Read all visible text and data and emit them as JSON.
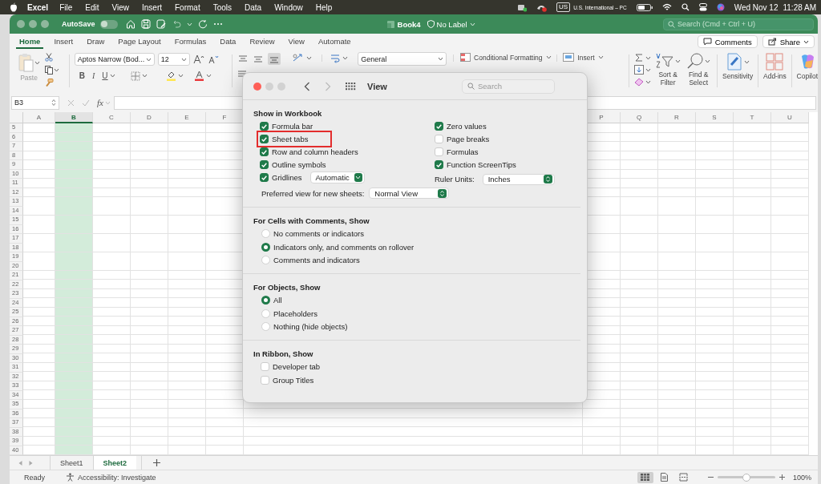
{
  "menu_bar": {
    "app": "Excel",
    "items": [
      "File",
      "Edit",
      "View",
      "Insert",
      "Format",
      "Tools",
      "Data",
      "Window",
      "Help"
    ],
    "keyboard_badge": "US",
    "keyboard_name": "U.S. International – PC",
    "date": "Wed Nov 12",
    "time": "11:28 AM"
  },
  "title_bar": {
    "autosave_label": "AutoSave",
    "autosave_on": false,
    "document": "Book4",
    "label": "No Label",
    "search_placeholder": "Search (Cmd + Ctrl + U)"
  },
  "tabs": [
    {
      "label": "Home",
      "selected": true
    },
    {
      "label": "Insert",
      "selected": false
    },
    {
      "label": "Draw",
      "selected": false
    },
    {
      "label": "Page Layout",
      "selected": false
    },
    {
      "label": "Formulas",
      "selected": false
    },
    {
      "label": "Data",
      "selected": false
    },
    {
      "label": "Review",
      "selected": false
    },
    {
      "label": "View",
      "selected": false
    },
    {
      "label": "Automate",
      "selected": false
    }
  ],
  "header_buttons": {
    "comments": "Comments",
    "share": "Share"
  },
  "ribbon": {
    "paste": "Paste",
    "font": "Aptos Narrow (Bod...",
    "font_size": "12",
    "bold": "B",
    "italic": "I",
    "underline": "U",
    "number_format": "General",
    "conditional_formatting": "Conditional Formatting",
    "insert": "Insert",
    "sort_filter": "Sort & Filter",
    "find_select": "Find & Select",
    "sensitivity": "Sensitivity",
    "add_ins": "Add-ins",
    "copilot": "Copilot"
  },
  "formula_bar": {
    "name_box": "B3",
    "fx": "fx"
  },
  "grid": {
    "columns_left": [
      {
        "label": "A",
        "selected": false
      },
      {
        "label": "B",
        "selected": true
      },
      {
        "label": "C",
        "selected": false
      },
      {
        "label": "D",
        "selected": false
      },
      {
        "label": "E",
        "selected": false
      },
      {
        "label": "F",
        "selected": false
      }
    ],
    "columns_right": [
      {
        "label": "P",
        "selected": false
      },
      {
        "label": "Q",
        "selected": false
      },
      {
        "label": "R",
        "selected": false
      },
      {
        "label": "S",
        "selected": false
      },
      {
        "label": "T",
        "selected": false
      },
      {
        "label": "U",
        "selected": false
      }
    ],
    "rows": [
      "5",
      "6",
      "7",
      "8",
      "9",
      "10",
      "11",
      "12",
      "13",
      "14",
      "15",
      "16",
      "17",
      "18",
      "19",
      "20",
      "21",
      "22",
      "23",
      "24",
      "25",
      "26",
      "27",
      "28",
      "29",
      "30",
      "31",
      "32",
      "33",
      "34",
      "35",
      "36",
      "37",
      "38",
      "39",
      "40"
    ]
  },
  "sheets": [
    {
      "label": "Sheet1",
      "selected": false
    },
    {
      "label": "Sheet2",
      "selected": true
    }
  ],
  "status_bar": {
    "status": "Ready",
    "accessibility": "Accessibility: Investigate",
    "views": [
      {
        "kind": "normal",
        "selected": true
      },
      {
        "kind": "page_layout",
        "selected": false
      },
      {
        "kind": "page_break",
        "selected": false
      }
    ],
    "zoom": {
      "level": 0.5,
      "reading": "100%"
    }
  },
  "dialog": {
    "title": "View",
    "search_placeholder": "Search",
    "sections": [
      {
        "kind": "workbook",
        "title": "Show in Workbook",
        "left": [
          {
            "label": "Formula bar",
            "checked": true,
            "highlighted": false
          },
          {
            "label": "Sheet tabs",
            "checked": true,
            "highlighted": true
          },
          {
            "label": "Row and column headers",
            "checked": true,
            "highlighted": false
          },
          {
            "label": "Outline symbols",
            "checked": true,
            "highlighted": false
          },
          {
            "label": "Gridlines",
            "checked": true,
            "highlighted": false,
            "dropdown": "Automatic"
          }
        ],
        "right": [
          {
            "kind": "checkbox",
            "label": "Zero values",
            "checked": true
          },
          {
            "kind": "checkbox",
            "label": "Page breaks",
            "checked": false
          },
          {
            "kind": "checkbox",
            "label": "Formulas",
            "checked": false
          },
          {
            "kind": "checkbox",
            "label": "Function ScreenTips",
            "checked": true
          },
          {
            "kind": "select",
            "label": "Ruler Units:",
            "value": "Inches"
          }
        ],
        "preferred": {
          "label": "Preferred view for new sheets:",
          "value": "Normal View"
        }
      },
      {
        "kind": "radios",
        "title": "For Cells with Comments, Show",
        "options": [
          {
            "label": "No comments or indicators",
            "selected": false
          },
          {
            "label": "Indicators only, and comments on rollover",
            "selected": true
          },
          {
            "label": "Comments and indicators",
            "selected": false
          }
        ]
      },
      {
        "kind": "radios",
        "title": "For Objects, Show",
        "options": [
          {
            "label": "All",
            "selected": true
          },
          {
            "label": "Placeholders",
            "selected": false
          },
          {
            "label": "Nothing (hide objects)",
            "selected": false
          }
        ]
      },
      {
        "kind": "checkboxes",
        "title": "In Ribbon, Show",
        "options": [
          {
            "label": "Developer tab",
            "checked": false
          },
          {
            "label": "Group Titles",
            "checked": false
          }
        ]
      }
    ]
  }
}
